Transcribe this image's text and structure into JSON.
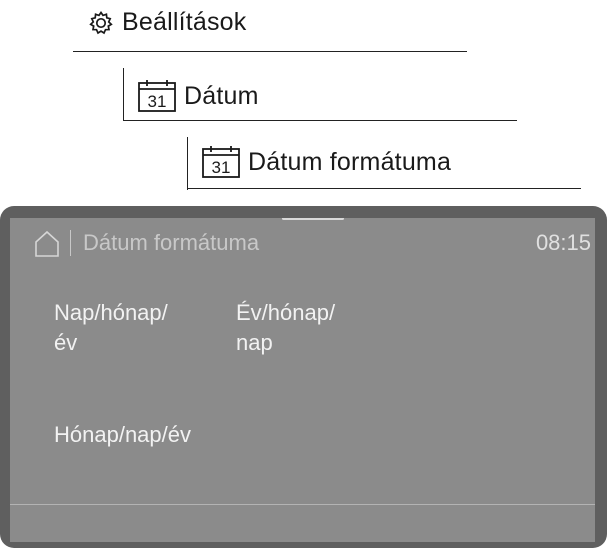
{
  "breadcrumb": {
    "level1": {
      "label": "Beállítások",
      "icon": "gear-icon"
    },
    "level2": {
      "label": "Dátum",
      "icon": "calendar-icon",
      "icon_number": "31"
    },
    "level3": {
      "label": "Dátum formátuma",
      "icon": "calendar-icon",
      "icon_number": "31"
    }
  },
  "display": {
    "home_icon": "home-icon",
    "title": "Dátum formátuma",
    "time": "08:15",
    "options": [
      {
        "line1": "Nap/hónap/",
        "line2": "év"
      },
      {
        "line1": "Év/hónap/",
        "line2": "nap"
      },
      {
        "line1": "Hónap/nap/év",
        "line2": ""
      }
    ]
  }
}
